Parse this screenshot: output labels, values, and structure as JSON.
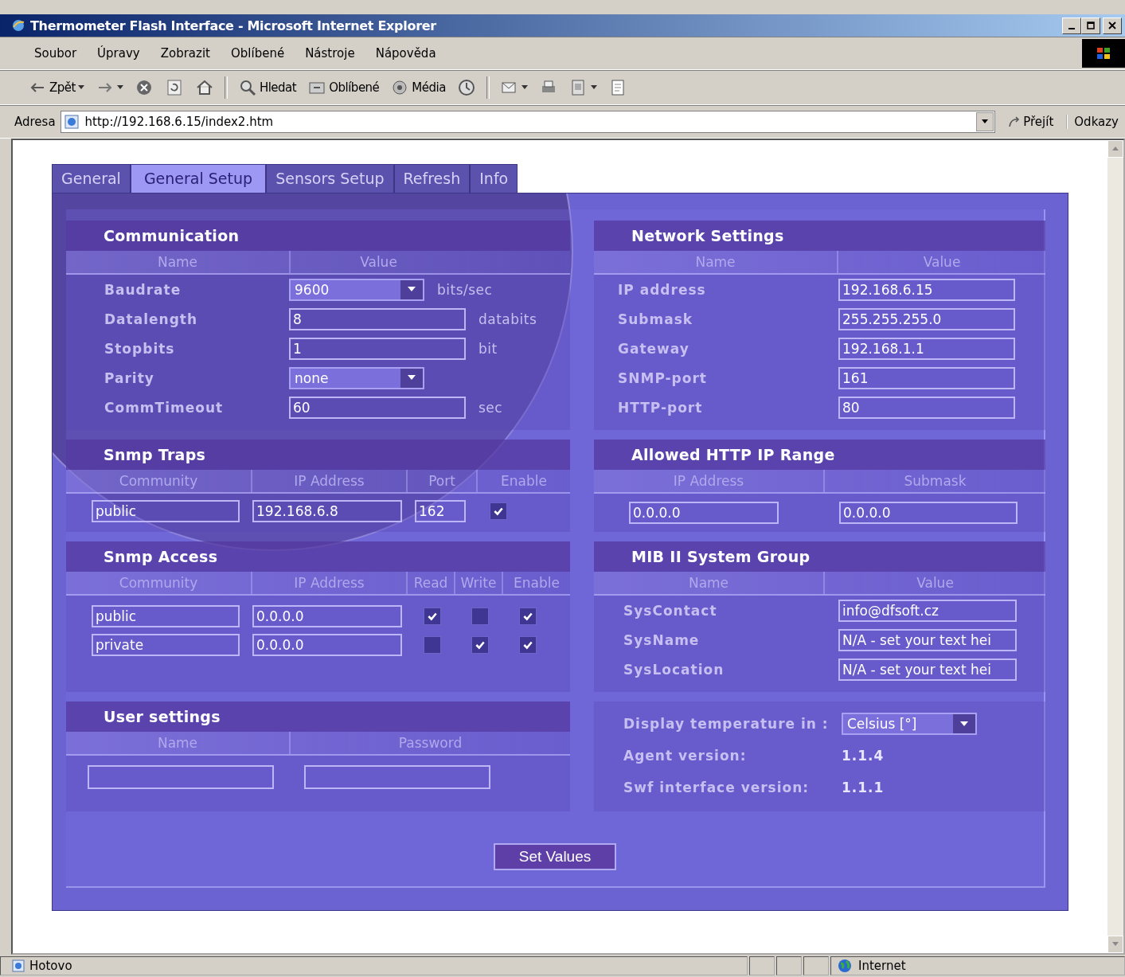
{
  "window": {
    "title": "Thermometer Flash Interface - Microsoft Internet Explorer"
  },
  "menu": [
    "Soubor",
    "Úpravy",
    "Zobrazit",
    "Oblíbené",
    "Nástroje",
    "Nápověda"
  ],
  "toolbar": [
    [
      {
        "kind": "back",
        "label": "Zpět",
        "dropdown": true
      },
      {
        "kind": "forward",
        "dropdown": true
      },
      {
        "kind": "stop"
      },
      {
        "kind": "refresh"
      },
      {
        "kind": "home"
      }
    ],
    [
      {
        "kind": "search",
        "label": "Hledat"
      },
      {
        "kind": "favorites",
        "label": "Oblíbené"
      },
      {
        "kind": "media",
        "label": "Média"
      },
      {
        "kind": "history"
      }
    ],
    [
      {
        "kind": "mail",
        "dropdown": true
      },
      {
        "kind": "print"
      },
      {
        "kind": "edit",
        "dropdown": true
      },
      {
        "kind": "discuss"
      }
    ]
  ],
  "address_bar": {
    "label": "Adresa",
    "url": "http://192.168.6.15/index2.htm",
    "go": "Přejít",
    "links": "Odkazy"
  },
  "tabs": [
    {
      "label": "General",
      "selected": false
    },
    {
      "label": "General Setup",
      "selected": true
    },
    {
      "label": "Sensors Setup",
      "selected": false
    },
    {
      "label": "Refresh",
      "selected": false
    },
    {
      "label": "Info",
      "selected": false
    }
  ],
  "communication": {
    "title": "Communication",
    "columns": [
      "Name",
      "Value"
    ],
    "rows": [
      {
        "label": "Baudrate",
        "kind": "select",
        "value": "9600",
        "unit": "bits/sec"
      },
      {
        "label": "Datalength",
        "kind": "input",
        "value": "8",
        "unit": "databits"
      },
      {
        "label": "Stopbits",
        "kind": "input",
        "value": "1",
        "unit": "bit"
      },
      {
        "label": "Parity",
        "kind": "select",
        "value": "none"
      },
      {
        "label": "CommTimeout",
        "kind": "input",
        "value": "60",
        "unit": "sec"
      }
    ]
  },
  "network_settings": {
    "title": "Network Settings",
    "columns": [
      "Name",
      "Value"
    ],
    "rows": [
      {
        "label": "IP address",
        "value": "192.168.6.15"
      },
      {
        "label": "Submask",
        "value": "255.255.255.0"
      },
      {
        "label": "Gateway",
        "value": "192.168.1.1"
      },
      {
        "label": "SNMP-port",
        "value": "161"
      },
      {
        "label": "HTTP-port",
        "value": "80"
      }
    ]
  },
  "snmp_traps": {
    "title": "Snmp Traps",
    "columns": [
      "Community",
      "IP Address",
      "Port",
      "Enable"
    ],
    "rows": [
      {
        "community": "public",
        "ip": "192.168.6.8",
        "port": "162",
        "enable": true
      }
    ]
  },
  "allowed_http_ip_range": {
    "title": "Allowed HTTP IP Range",
    "columns": [
      "IP Address",
      "Submask"
    ],
    "values": [
      "0.0.0.0",
      "0.0.0.0"
    ]
  },
  "snmp_access": {
    "title": "Snmp Access",
    "columns": [
      "Community",
      "IP Address",
      "Read",
      "Write",
      "Enable"
    ],
    "rows": [
      {
        "community": "public",
        "ip": "0.0.0.0",
        "read": true,
        "write": false,
        "enable": true
      },
      {
        "community": "private",
        "ip": "0.0.0.0",
        "read": false,
        "write": true,
        "enable": true
      }
    ]
  },
  "mib_ii_system_group": {
    "title": "MIB II System Group",
    "columns": [
      "Name",
      "Value"
    ],
    "rows": [
      {
        "label": "SysContact",
        "value": "info@dfsoft.cz"
      },
      {
        "label": "SysName",
        "value": "N/A - set your text hei"
      },
      {
        "label": "SysLocation",
        "value": "N/A - set your text hei"
      }
    ]
  },
  "user_settings": {
    "title": "User settings",
    "columns": [
      "Name",
      "Password"
    ]
  },
  "display": {
    "label": "Display temperature in :",
    "value": "Celsius [°]",
    "versions": [
      {
        "label": "Agent version:",
        "value": "1.1.4"
      },
      {
        "label": "Swf interface version:",
        "value": "1.1.1"
      }
    ]
  },
  "set_button": "Set Values",
  "status_bar": {
    "text": "Hotovo",
    "zone": "Internet"
  }
}
